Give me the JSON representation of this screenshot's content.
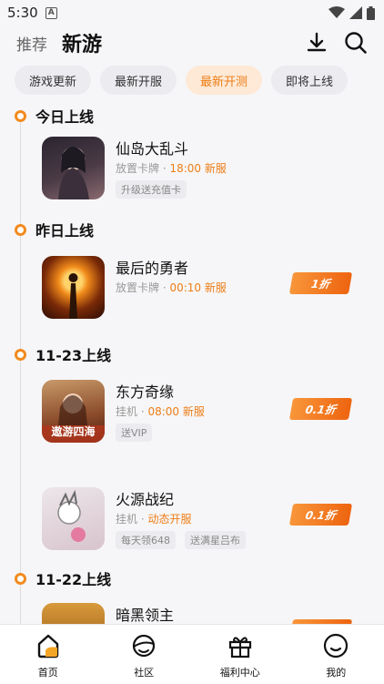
{
  "status": {
    "time": "5:30",
    "notif_badge": "A"
  },
  "nav": {
    "tab_recommend": "推荐",
    "tab_new": "新游"
  },
  "filters": [
    "游戏更新",
    "最新开服",
    "最新开测",
    "即将上线"
  ],
  "sections": [
    {
      "title": "今日上线"
    },
    {
      "title": "昨日上线"
    },
    {
      "title": "11-23上线"
    },
    {
      "title": "11-22上线"
    }
  ],
  "games": [
    {
      "name": "仙岛大乱斗",
      "genre": "放置卡牌 · ",
      "highlight": "18:00 新服",
      "tags": [
        "升级送充值卡"
      ],
      "discount": ""
    },
    {
      "name": "最后的勇者",
      "genre": "放置卡牌 · ",
      "highlight": "00:10 新服",
      "tags": [],
      "discount": "1折"
    },
    {
      "name": "东方奇缘",
      "genre": "挂机 · ",
      "highlight": "08:00 新服",
      "tags": [
        "送VIP"
      ],
      "discount": "0.1折",
      "icon_text": "遨游四海"
    },
    {
      "name": "火源战纪",
      "genre": "挂机 · ",
      "highlight": "动态开服",
      "tags": [
        "每天领648",
        "送满星吕布"
      ],
      "discount": "0.1折"
    },
    {
      "name": "暗黑领主",
      "genre": "",
      "highlight": "",
      "tags": [],
      "discount": ""
    }
  ],
  "bottom_nav": [
    {
      "label": "首页",
      "icon": "home-icon"
    },
    {
      "label": "社区",
      "icon": "community-icon"
    },
    {
      "label": "福利中心",
      "icon": "gift-icon"
    },
    {
      "label": "我的",
      "icon": "profile-icon"
    }
  ],
  "colors": {
    "accent": "#ee7d15",
    "chip_active_bg": "#fde9d6",
    "discount_start": "#f8963a",
    "discount_end": "#ee6410"
  }
}
